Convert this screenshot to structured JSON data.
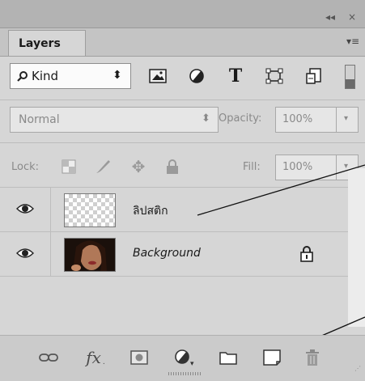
{
  "panel": {
    "tab_label": "Layers",
    "collapse_glyph": "◂◂",
    "close_glyph": "×",
    "menu_glyph": "▾≡"
  },
  "filter": {
    "kind_label": "Kind",
    "kind_arrows": "⬍",
    "icons": [
      "image-filter-icon",
      "adjustment-filter-icon",
      "type-filter-icon",
      "shape-filter-icon",
      "smart-object-filter-icon",
      "filter-toggle-icon"
    ]
  },
  "blend": {
    "mode": "Normal",
    "opacity_label": "Opacity:",
    "opacity_value": "100%"
  },
  "lock": {
    "label": "Lock:",
    "fill_label": "Fill:",
    "fill_value": "100%"
  },
  "layers": [
    {
      "name": "ลิปสติก",
      "italic": false,
      "locked": false,
      "thumb": "transparent"
    },
    {
      "name": "Background",
      "italic": true,
      "locked": true,
      "thumb": "photo"
    }
  ],
  "bottom_icons": [
    "link-layers-icon",
    "fx-icon",
    "mask-icon",
    "adjustment-layer-icon",
    "group-folder-icon",
    "new-layer-icon",
    "delete-icon"
  ]
}
